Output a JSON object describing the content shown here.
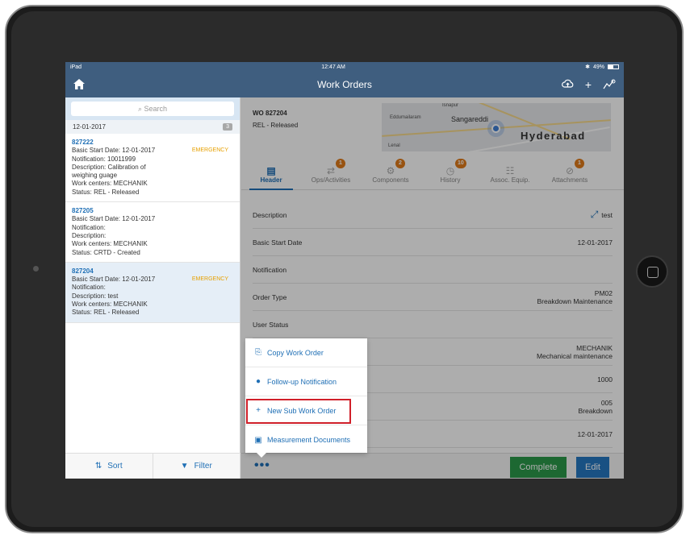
{
  "status_bar": {
    "left": "iPad",
    "time": "12:47 AM",
    "battery": "49%"
  },
  "nav": {
    "title": "Work Orders"
  },
  "master": {
    "search_placeholder": "Search",
    "group": {
      "date": "12-01-2017",
      "count": "3"
    },
    "items": [
      {
        "id": "827222",
        "tag": "EMERGENCY",
        "lines": [
          "Basic Start Date: 12-01-2017",
          "Notification: 10011999",
          "Description: Calibration of",
          "weighing guage",
          "Work centers: MECHANIK",
          "Status: REL - Released"
        ]
      },
      {
        "id": "827205",
        "tag": "",
        "lines": [
          "Basic Start Date: 12-01-2017",
          "Notification:",
          "Description:",
          "Work centers: MECHANIK",
          "Status: CRTD - Created"
        ]
      },
      {
        "id": "827204",
        "tag": "EMERGENCY",
        "lines": [
          "Basic Start Date: 12-01-2017",
          "Notification:",
          "Description: test",
          "Work centers: MECHANIK",
          "Status: REL - Released"
        ]
      }
    ],
    "sort_label": "Sort",
    "filter_label": "Filter"
  },
  "detail": {
    "wo_number": "WO 827204",
    "wo_status": "REL - Released",
    "map": {
      "city": "Hyderabad",
      "place1": "Sangareddi",
      "place2": "Eddumailaram",
      "place3": "Lenal",
      "place4": "Isnapur"
    },
    "tabs": [
      {
        "label": "Header",
        "badge": ""
      },
      {
        "label": "Ops/Activities",
        "badge": "1"
      },
      {
        "label": "Components",
        "badge": "2"
      },
      {
        "label": "History",
        "badge": "10"
      },
      {
        "label": "Assoc. Equip.",
        "badge": ""
      },
      {
        "label": "Attachments",
        "badge": "1"
      }
    ],
    "fields": [
      {
        "label": "Description",
        "value1": "test",
        "value2": ""
      },
      {
        "label": "Basic Start Date",
        "value1": "12-01-2017",
        "value2": ""
      },
      {
        "label": "Notification",
        "value1": "",
        "value2": ""
      },
      {
        "label": "Order Type",
        "value1": "PM02",
        "value2": "Breakdown Maintenance"
      },
      {
        "label": "User Status",
        "value1": "",
        "value2": ""
      },
      {
        "label": "",
        "value1": "MECHANIK",
        "value2": "Mechanical maintenance"
      },
      {
        "label": "",
        "value1": "1000",
        "value2": ""
      },
      {
        "label": "",
        "value1": "005",
        "value2": "Breakdown"
      },
      {
        "label": "",
        "value1": "12-01-2017",
        "value2": ""
      }
    ],
    "more_label": "•••",
    "complete_label": "Complete",
    "edit_label": "Edit"
  },
  "popover": {
    "items": [
      {
        "label": "Copy Work Order",
        "icon": "copy-icon"
      },
      {
        "label": "Follow-up Notification",
        "icon": "notification-icon"
      },
      {
        "label": "New Sub Work Order",
        "icon": "plus-icon"
      },
      {
        "label": "Measurement Documents",
        "icon": "measurement-icon"
      }
    ]
  },
  "colors": {
    "nav": "#3f5e7f",
    "accent": "#1f6fb5",
    "emergency": "#e7a000",
    "complete": "#2c9a4a",
    "highlight": "#d0202a"
  }
}
